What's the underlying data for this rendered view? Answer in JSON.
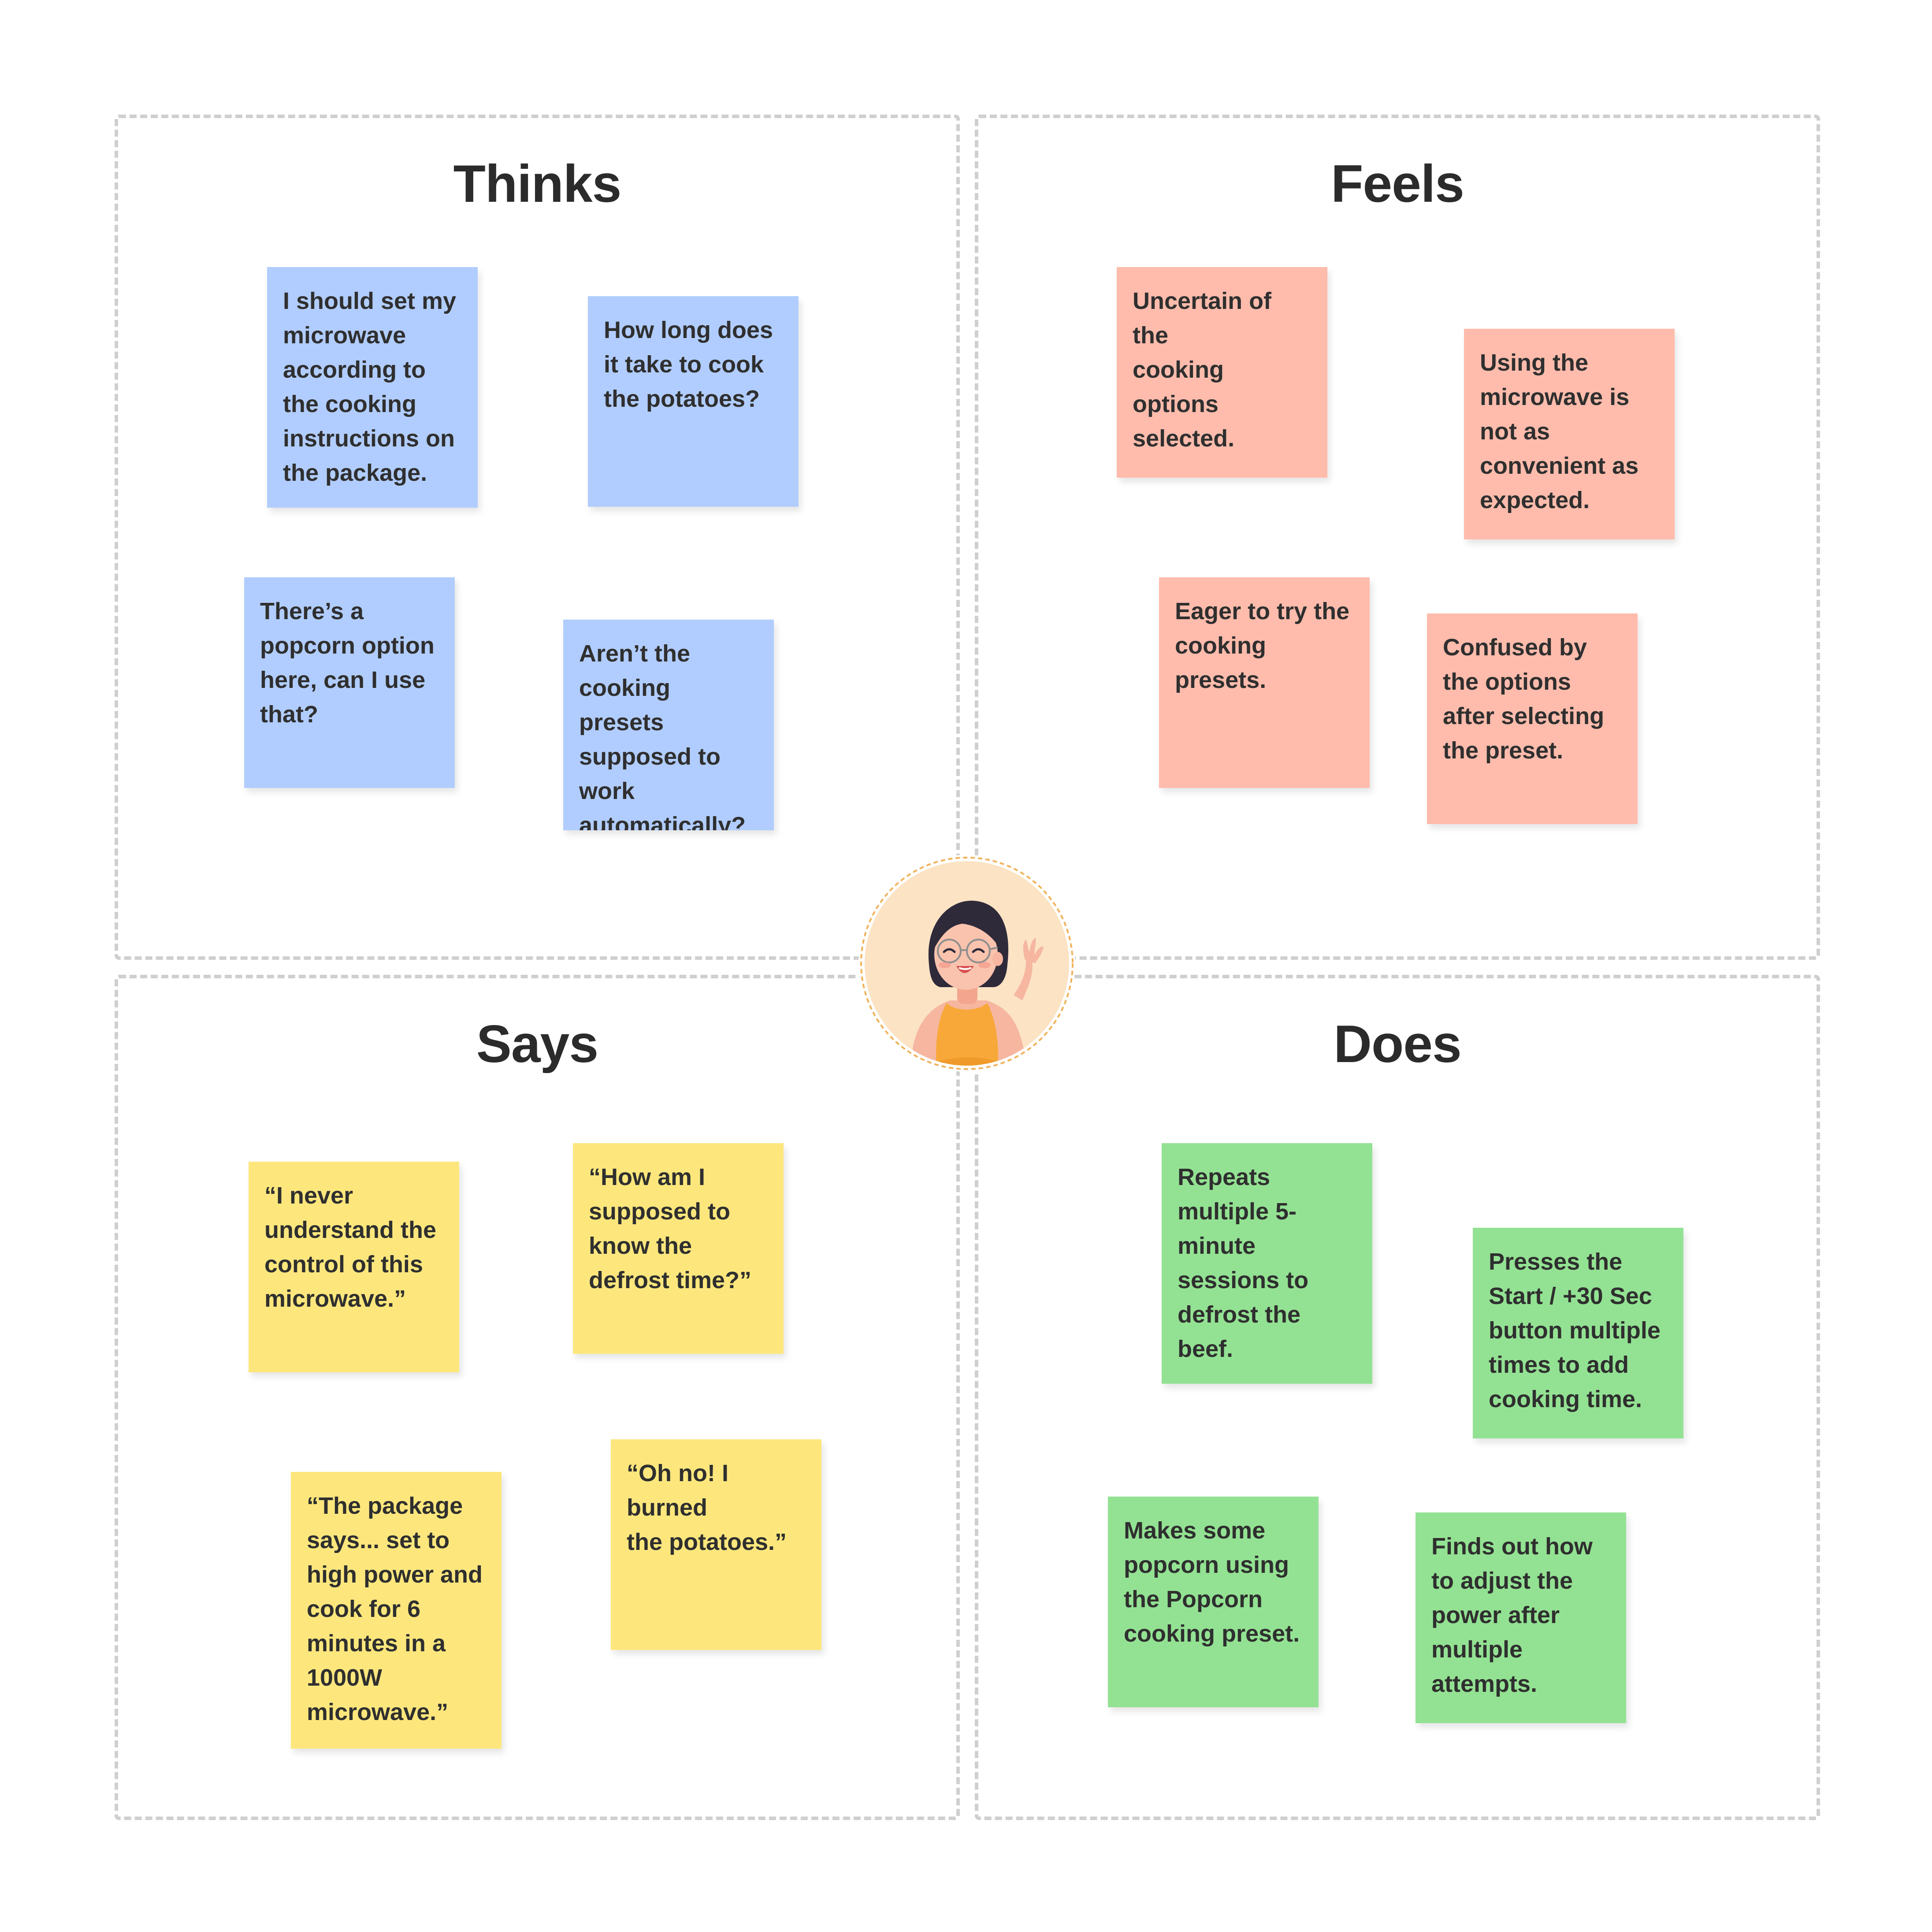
{
  "quadrants": {
    "thinks": {
      "title": "Thinks",
      "notes": [
        "I should set my\nmicrowave\naccording to\nthe cooking\ninstructions on\nthe package.",
        "How long does\nit take to cook\nthe potatoes?",
        "There’s a\npopcorn option\nhere, can I use\nthat?",
        "Aren’t the\ncooking presets\nsupposed to\nwork\nautomatically?"
      ]
    },
    "feels": {
      "title": "Feels",
      "notes": [
        "Uncertain of the\ncooking options\nselected.",
        "Using the\nmicrowave is\nnot as\nconvenient as\nexpected.",
        "Eager to try the\ncooking\npresets.",
        "Confused by\nthe options\nafter selecting\nthe preset."
      ]
    },
    "says": {
      "title": "Says",
      "notes": [
        "“I never\nunderstand the\ncontrol  of this\nmicrowave.”",
        "“How am I\nsupposed to\nknow the\ndefrost time?”",
        "“The package\nsays... set to\nhigh power and\ncook for 6\nminutes in a\n1000W\nmicrowave.”",
        "“Oh no! I burned\nthe potatoes.”"
      ]
    },
    "does": {
      "title": "Does",
      "notes": [
        "Repeats\nmultiple 5-\nminute\nsessions to\ndefrost the\nbeef.",
        "Presses the\nStart / +30 Sec\nbutton multiple\ntimes to add\ncooking time.",
        "Makes some\npopcorn using\nthe Popcorn\ncooking preset.",
        "Finds out how\nto adjust the\npower after\nmultiple\nattempts."
      ]
    }
  },
  "colors": {
    "thinks_note": "#b1cdff",
    "feels_note": "#ffbcac",
    "says_note": "#fde77d",
    "does_note": "#93e293",
    "frame_dashes": "#cfcfcf",
    "persona_ring": "#f0b25a",
    "persona_bg": "#fbe3c4"
  },
  "persona": {
    "icon": "waving-woman-avatar-icon"
  }
}
